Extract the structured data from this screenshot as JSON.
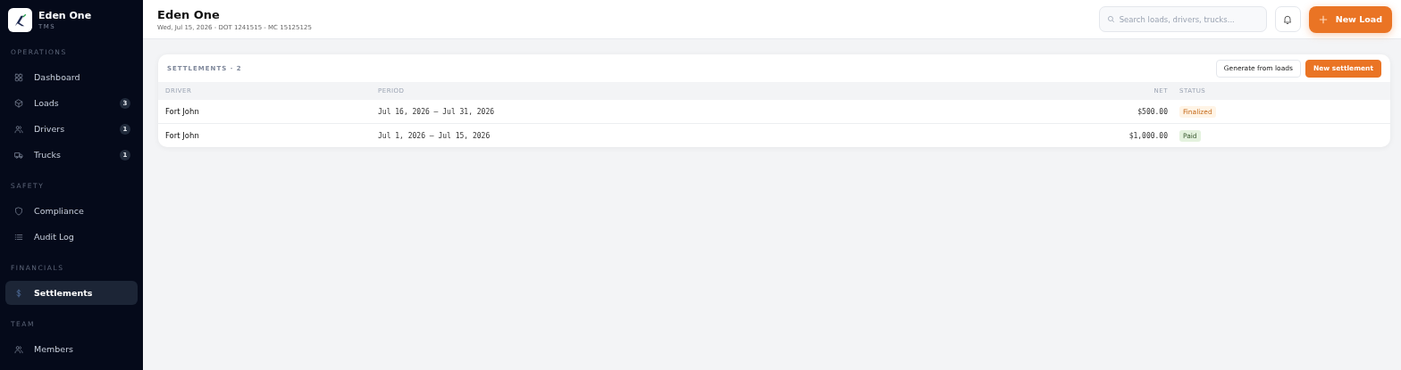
{
  "brand": {
    "name": "Eden One",
    "subtitle": "TMS"
  },
  "sidebar": {
    "sections": [
      {
        "title": "OPERATIONS",
        "items": [
          {
            "label": "Dashboard",
            "selected": false
          },
          {
            "label": "Loads",
            "badge": "3",
            "selected": false
          },
          {
            "label": "Drivers",
            "badge": "1",
            "selected": false
          },
          {
            "label": "Trucks",
            "badge": "1",
            "selected": false
          }
        ]
      },
      {
        "title": "SAFETY",
        "items": [
          {
            "label": "Compliance",
            "selected": false
          },
          {
            "label": "Audit Log",
            "selected": false
          }
        ]
      },
      {
        "title": "FINANCIALS",
        "items": [
          {
            "label": "Settlements",
            "selected": true
          }
        ]
      },
      {
        "title": "TEAM",
        "items": [
          {
            "label": "Members",
            "selected": false
          }
        ]
      }
    ]
  },
  "header": {
    "title": "Eden One",
    "subtitle": "Wed, Jul 15, 2026 - DOT 1241515 - MC 15125125",
    "search": {
      "placeholder": "Search loads, drivers, trucks..."
    },
    "primary_button": "New Load"
  },
  "card": {
    "title": "SETTLEMENTS · 2",
    "buttons": [
      "Generate from loads",
      "New settlement"
    ],
    "table": {
      "columns": [
        "DRIVER",
        "PERIOD",
        "NET",
        "STATUS"
      ],
      "rows": [
        {
          "driver": "Fort John",
          "period": "Jul 16, 2026 – Jul 31, 2026",
          "net": "$500.00",
          "status": "Finalized",
          "kind": "finalized"
        },
        {
          "driver": "Fort John",
          "period": "Jul 1, 2026 – Jul 15, 2026",
          "net": "$1,000.00",
          "status": "Paid",
          "kind": "paid"
        }
      ]
    }
  }
}
